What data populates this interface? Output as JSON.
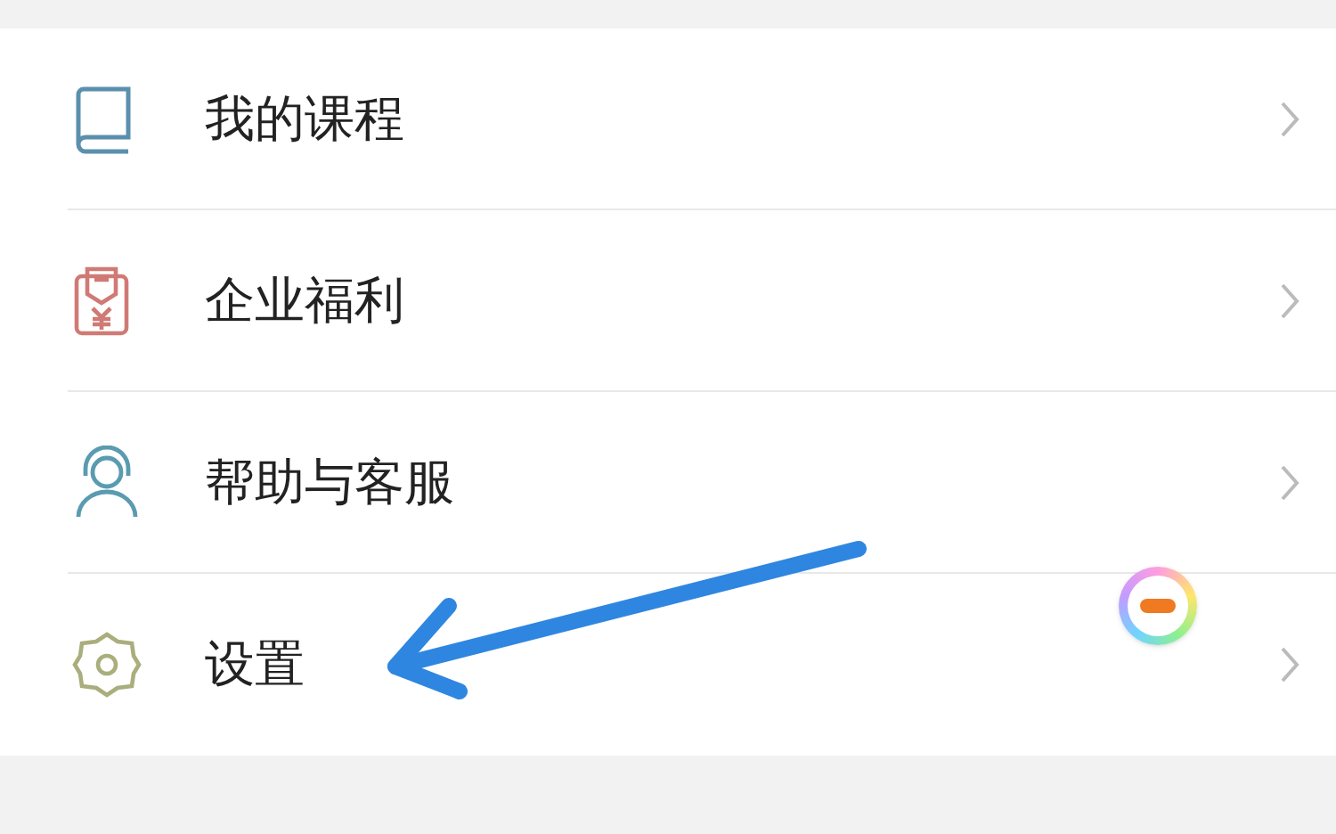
{
  "menu": {
    "items": [
      {
        "label": "我的课程",
        "kind": "book"
      },
      {
        "label": "企业福利",
        "kind": "gift"
      },
      {
        "label": "帮助与客服",
        "kind": "support"
      },
      {
        "label": "设置",
        "kind": "settings"
      }
    ]
  }
}
